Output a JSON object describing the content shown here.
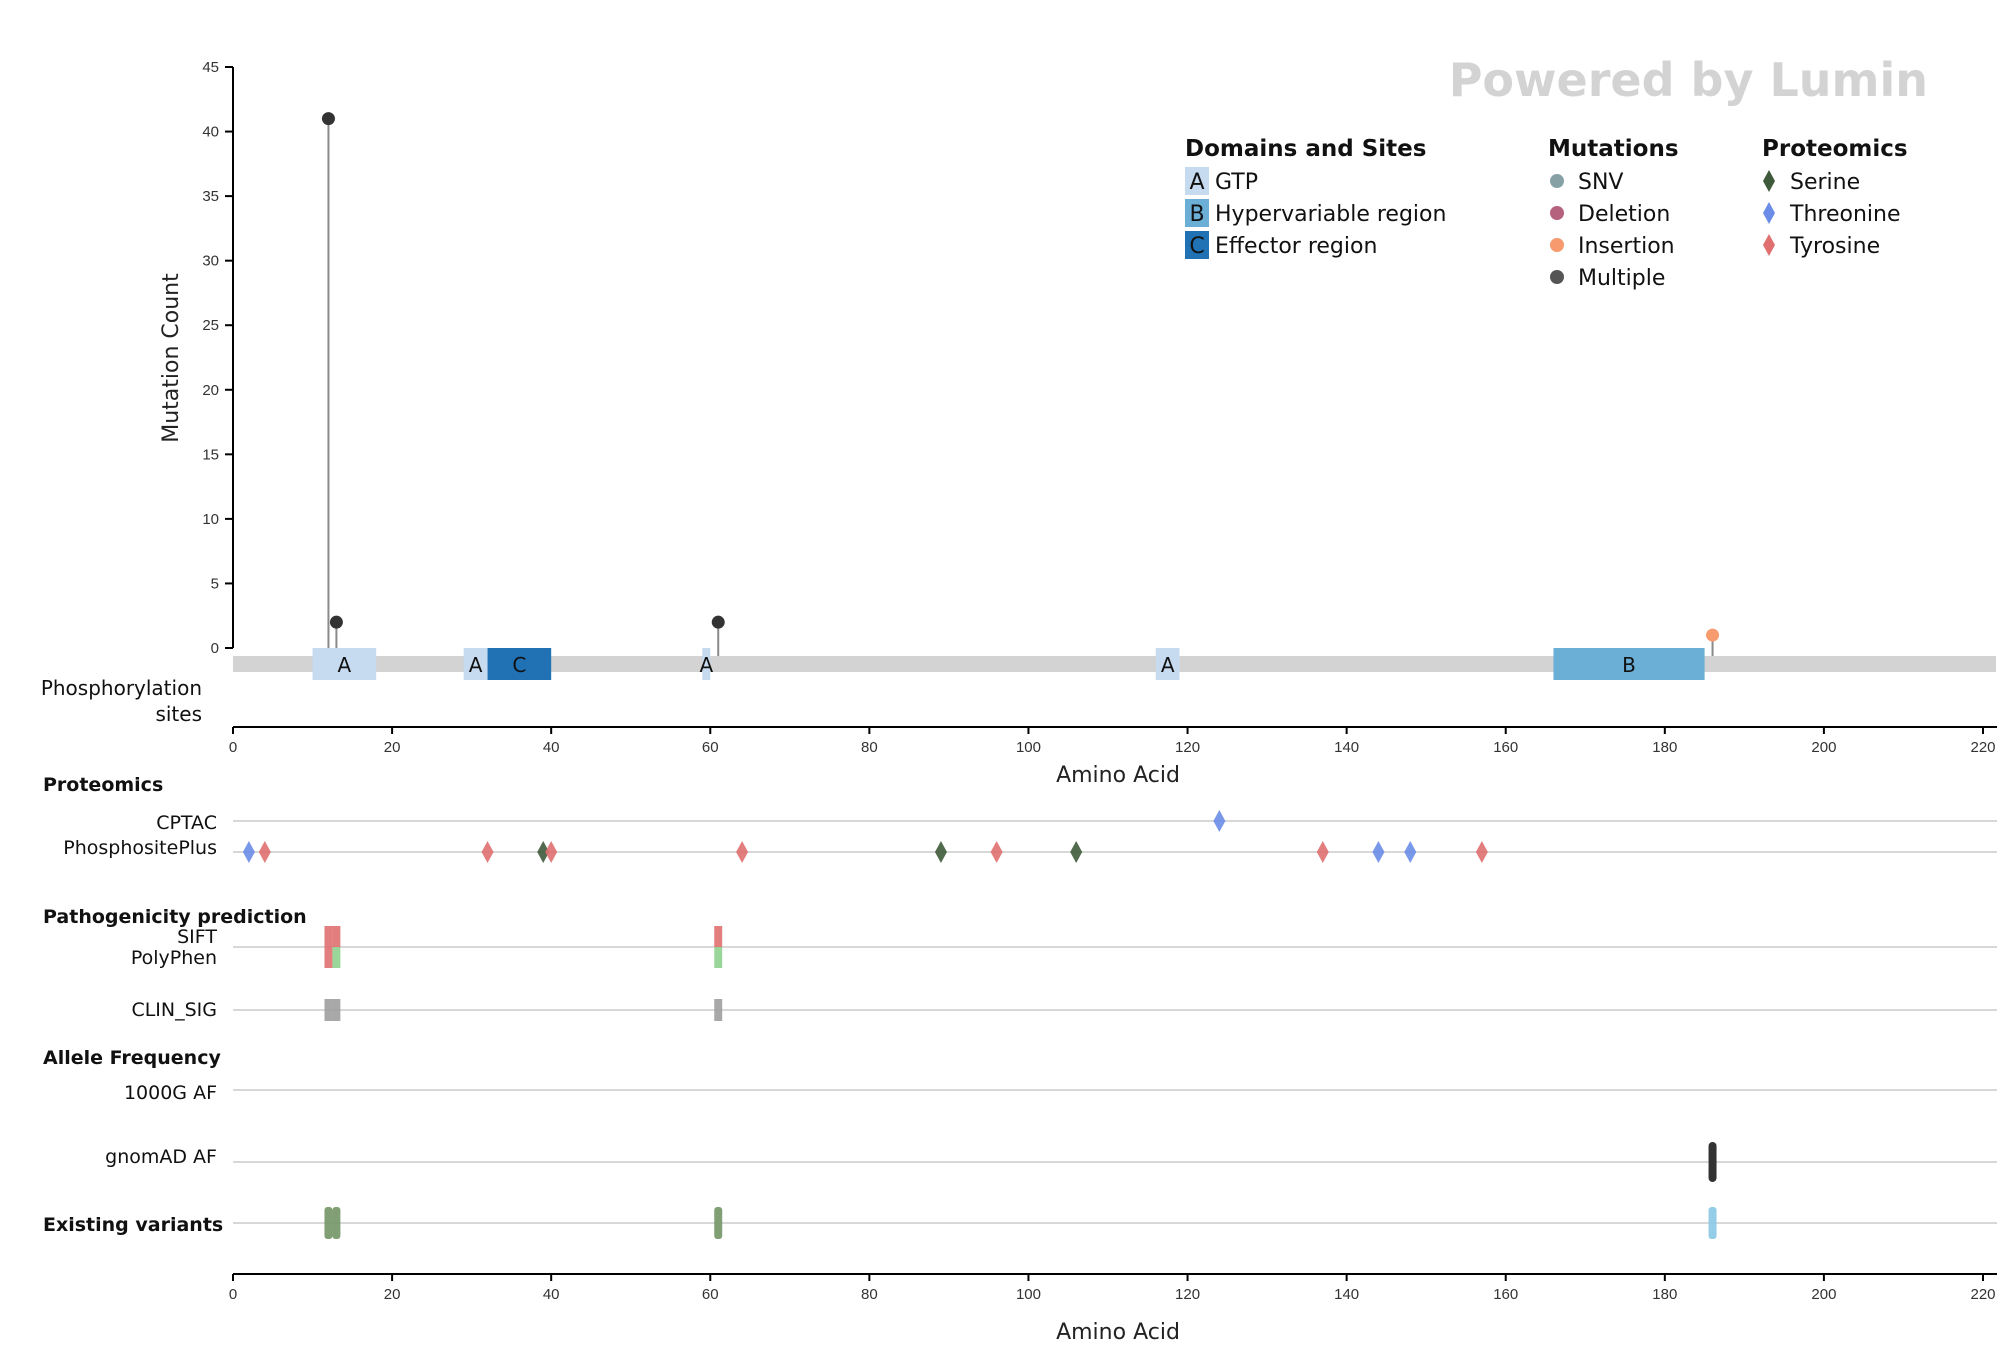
{
  "watermark": "Powered by Lumin",
  "chart_data": {
    "type": "scatter",
    "title": "",
    "lollipop": {
      "xlabel": "Amino Acid",
      "ylabel": "Mutation Count",
      "xlim": [
        0,
        222
      ],
      "ylim": [
        0,
        45
      ],
      "xticks": [
        0,
        20,
        40,
        60,
        80,
        100,
        120,
        140,
        160,
        180,
        200,
        220
      ],
      "yticks": [
        0,
        5,
        10,
        15,
        20,
        25,
        30,
        35,
        40,
        45
      ],
      "points": [
        {
          "position": 12,
          "count": 41,
          "type": "Multiple"
        },
        {
          "position": 13,
          "count": 2,
          "type": "Multiple"
        },
        {
          "position": 61,
          "count": 2,
          "type": "Multiple"
        },
        {
          "position": 186,
          "count": 1,
          "type": "Insertion"
        }
      ]
    },
    "protein_track": {
      "label": "Phosphorylation sites",
      "length": 222,
      "domains": [
        {
          "code": "A",
          "start": 10,
          "end": 18,
          "name": "GTP"
        },
        {
          "code": "A",
          "start": 29,
          "end": 32,
          "name": "GTP"
        },
        {
          "code": "C",
          "start": 32,
          "end": 40,
          "name": "Effector region"
        },
        {
          "code": "A",
          "start": 59,
          "end": 60,
          "name": "GTP"
        },
        {
          "code": "A",
          "start": 116,
          "end": 119,
          "name": "GTP"
        },
        {
          "code": "B",
          "start": 166,
          "end": 185,
          "name": "Hypervariable region"
        }
      ]
    },
    "legends": {
      "domains": {
        "title": "Domains and Sites",
        "items": [
          {
            "code": "A",
            "label": "GTP",
            "color": "#c6dbef"
          },
          {
            "code": "B",
            "label": "Hypervariable region",
            "color": "#6baed6"
          },
          {
            "code": "C",
            "label": "Effector region",
            "color": "#2171b5"
          }
        ]
      },
      "mutations": {
        "title": "Mutations",
        "items": [
          {
            "label": "SNV",
            "color": "#87a0a6"
          },
          {
            "label": "Deletion",
            "color": "#b5627e"
          },
          {
            "label": "Insertion",
            "color": "#f79b6e"
          },
          {
            "label": "Multiple",
            "color": "#555555"
          }
        ]
      },
      "proteomics": {
        "title": "Proteomics",
        "items": [
          {
            "label": "Serine",
            "color": "#3f5a3a"
          },
          {
            "label": "Threonine",
            "color": "#6b8de8"
          },
          {
            "label": "Tyrosine",
            "color": "#e07070"
          }
        ]
      }
    },
    "tracks": {
      "proteomics_title": "Proteomics",
      "cptac": {
        "label": "CPTAC",
        "sites": [
          {
            "position": 124,
            "residue": "Threonine"
          }
        ]
      },
      "phosphositeplus": {
        "label": "PhosphositePlus",
        "sites": [
          {
            "position": 2,
            "residue": "Threonine"
          },
          {
            "position": 4,
            "residue": "Tyrosine"
          },
          {
            "position": 32,
            "residue": "Tyrosine"
          },
          {
            "position": 39,
            "residue": "Serine"
          },
          {
            "position": 40,
            "residue": "Tyrosine"
          },
          {
            "position": 64,
            "residue": "Tyrosine"
          },
          {
            "position": 89,
            "residue": "Serine"
          },
          {
            "position": 96,
            "residue": "Tyrosine"
          },
          {
            "position": 106,
            "residue": "Serine"
          },
          {
            "position": 137,
            "residue": "Tyrosine"
          },
          {
            "position": 144,
            "residue": "Threonine"
          },
          {
            "position": 148,
            "residue": "Threonine"
          },
          {
            "position": 157,
            "residue": "Tyrosine"
          }
        ]
      },
      "pathogenicity_title": "Pathogenicity prediction",
      "sift": {
        "label": "SIFT",
        "marks": [
          {
            "position": 12,
            "color": "#e07070"
          },
          {
            "position": 13,
            "color": "#e07070"
          },
          {
            "position": 61,
            "color": "#e07070"
          }
        ]
      },
      "polyphen": {
        "label": "PolyPhen",
        "marks": [
          {
            "position": 12,
            "color": "#e07070"
          },
          {
            "position": 13,
            "color": "#8fd18f"
          },
          {
            "position": 61,
            "color": "#8fd18f"
          }
        ]
      },
      "clin_sig": {
        "label": "CLIN_SIG",
        "marks": [
          {
            "position": 12,
            "color": "#9e9e9e"
          },
          {
            "position": 13,
            "color": "#9e9e9e"
          },
          {
            "position": 61,
            "color": "#9e9e9e"
          }
        ]
      },
      "allele_title": "Allele Frequency",
      "g1000": {
        "label": "1000G AF",
        "marks": []
      },
      "gnomad": {
        "label": "gnomAD AF",
        "marks": [
          {
            "position": 186,
            "color": "#333333"
          }
        ]
      },
      "existing": {
        "label": "Existing variants",
        "marks": [
          {
            "position": 12,
            "color": "#7a9a6e"
          },
          {
            "position": 13,
            "color": "#7a9a6e"
          },
          {
            "position": 61,
            "color": "#7a9a6e"
          },
          {
            "position": 186,
            "color": "#8ecae6"
          }
        ]
      }
    },
    "bottom_axis": {
      "xlabel": "Amino Acid",
      "xticks": [
        0,
        20,
        40,
        60,
        80,
        100,
        120,
        140,
        160,
        180,
        200,
        220
      ]
    }
  }
}
